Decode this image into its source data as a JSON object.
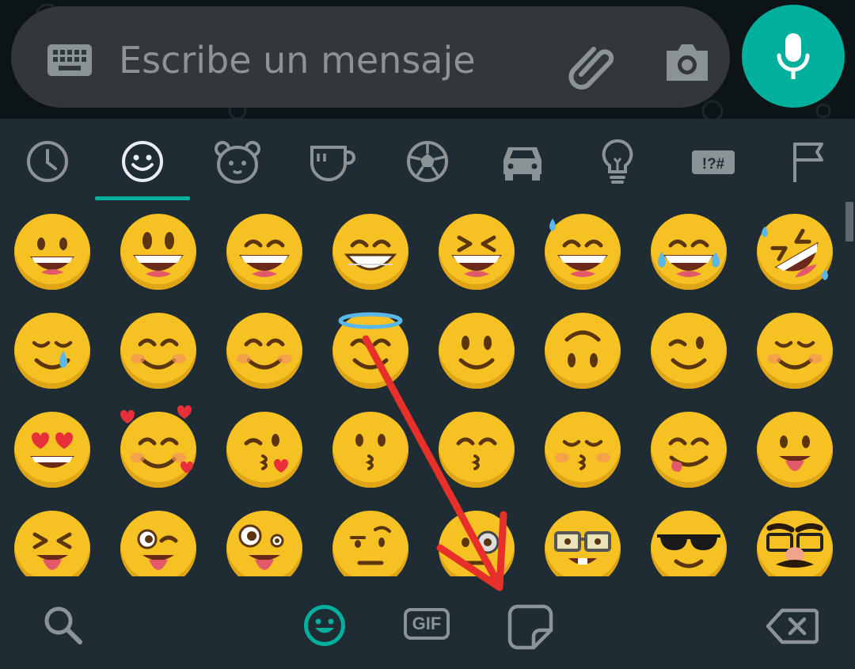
{
  "input": {
    "placeholder": "Escribe un mensaje"
  },
  "icons": {
    "keyboard": "keyboard-icon",
    "attach": "paperclip-icon",
    "camera": "camera-icon",
    "mic": "mic-icon"
  },
  "emoji_tabs": [
    {
      "name": "recent-clock-icon"
    },
    {
      "name": "smiley-icon",
      "active": true
    },
    {
      "name": "bear-icon"
    },
    {
      "name": "cup-icon"
    },
    {
      "name": "soccer-ball-icon"
    },
    {
      "name": "car-icon"
    },
    {
      "name": "lightbulb-icon"
    },
    {
      "name": "symbols-icon",
      "label": "!?#"
    },
    {
      "name": "flag-icon"
    }
  ],
  "emoji_rows": [
    [
      "grinning",
      "grinning-big-eyes",
      "grinning-smiling-eyes",
      "beaming",
      "grinning-squinting",
      "grinning-sweat",
      "tears-of-joy",
      "rolling-on-floor-laughing"
    ],
    [
      "smiling-with-tear",
      "smiling-blush",
      "smiling-eyes",
      "halo",
      "slightly-smiling",
      "upside-down",
      "winking",
      "relieved"
    ],
    [
      "heart-eyes",
      "smiling-with-hearts",
      "kissing-heart",
      "kissing",
      "kissing-smiling-eyes",
      "kissing-closed-eyes",
      "yum",
      "tongue-out"
    ],
    [
      "squinting-tongue",
      "winking-tongue",
      "zany",
      "raised-eyebrow",
      "monocle",
      "nerd",
      "sunglasses",
      "disguised"
    ]
  ],
  "bottom_bar": {
    "search": "search-icon",
    "emoji": "emoji-tab-icon",
    "gif_label": "GIF",
    "sticker": "sticker-icon",
    "backspace": "backspace-icon"
  },
  "colors": {
    "accent": "#00af9c",
    "panel": "#1f2c34",
    "input": "#323739",
    "icon_gray": "#8c9397",
    "annotation_arrow": "#e8302a"
  }
}
